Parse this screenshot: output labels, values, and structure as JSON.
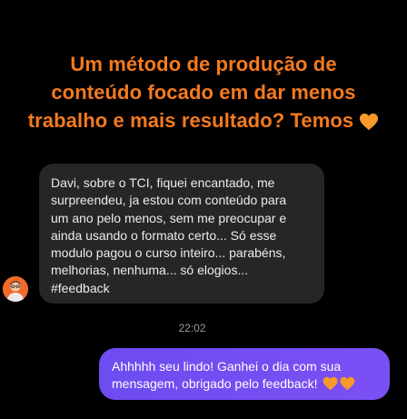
{
  "headline": {
    "line1": "Um método de produção de",
    "line2": "conteúdo focado em dar menos",
    "line3": "trabalho e mais resultado? Temos",
    "heart_icon": "orange-heart-icon",
    "color": "#f47a1f"
  },
  "incoming_message": {
    "text": "Davi, sobre o TCI, fiquei encantado, me\nsurpreendeu, ja estou com conteúdo para\num ano pelo menos, sem me preocupar e\nainda usando o formato certo... Só esse\nmodulo pagou o curso inteiro... parabéns,\nmelhorias, nenhuma... só elogios...\n#feedback",
    "avatar_icon": "user-avatar-icon"
  },
  "timestamp": "22:02",
  "outgoing_message": {
    "line1": "Ahhhhh seu lindo! Ganhei o dia com sua",
    "line2": "mensagem, obrigado pelo feedback!",
    "hearts_icon": "orange-hearts-icon",
    "bubble_color": "#7350f2"
  }
}
